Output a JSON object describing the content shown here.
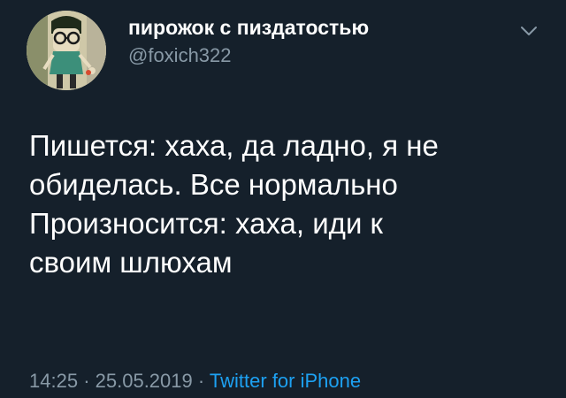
{
  "user": {
    "display_name": "пирожок с пиздатостью",
    "handle": "@foxich322"
  },
  "menu_icon": "chevron-down-icon",
  "tweet": {
    "lines": [
      "Пишется: хаха, да ладно, я не",
      "обиделась. Все нормально",
      "Произносится: хаха, иди к",
      "своим шлюхам"
    ],
    "time": "14:25",
    "separator": "·",
    "date": "25.05.2019",
    "source": "Twitter for iPhone"
  },
  "colors": {
    "background": "#15202b",
    "text": "#ffffff",
    "secondary": "#8899a6",
    "link": "#1da1f2"
  }
}
